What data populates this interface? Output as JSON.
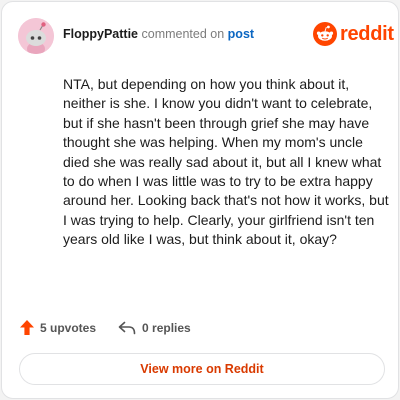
{
  "comment": {
    "username": "FloppyPattie",
    "action_text": "commented on",
    "post_link": "post",
    "body": "NTA, but depending on how you think about it, neither is she. I know you didn't want to celebrate, but if she hasn't been through grief she may have thought she was helping. When my mom's uncle died she was really sad about it, but all I knew what to do when I was little was to try to be extra happy around her. Looking back that's not how it works, but I was trying to help. Clearly, your girlfriend isn't ten years old like I was, but think about it, okay?",
    "upvotes_label": "5 upvotes",
    "replies_label": "0 replies"
  },
  "brand": {
    "name": "reddit",
    "accent": "#ff4500",
    "link_color": "#0a66c2"
  },
  "footer": {
    "button_label": "View more on Reddit"
  },
  "icons": {
    "avatar": "snoo-avatar-icon",
    "logo": "reddit-snoo-icon",
    "upvote": "upvote-arrow-icon",
    "reply": "reply-arrow-icon"
  }
}
